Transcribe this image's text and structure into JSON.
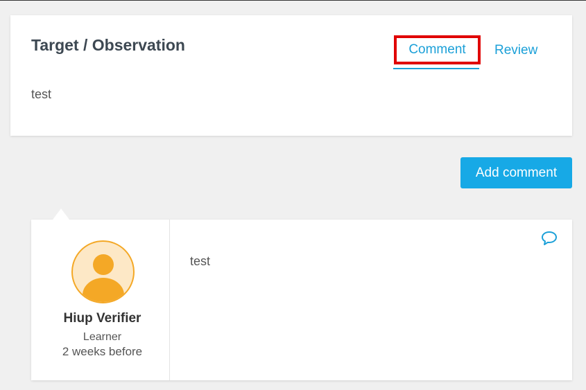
{
  "header": {
    "title": "Target / Observation",
    "description": "test",
    "tabs": [
      {
        "label": "Comment",
        "active": true
      },
      {
        "label": "Review",
        "active": false
      }
    ]
  },
  "actions": {
    "add_comment_label": "Add comment"
  },
  "comments": [
    {
      "author_name": "Hiup Verifier",
      "author_role": "Learner",
      "time": "2 weeks before",
      "text": "test",
      "avatar_icon": "user-avatar-icon",
      "reply_icon": "speech-bubble-icon"
    }
  ],
  "colors": {
    "accent": "#1ba0d8",
    "button": "#17a9e6",
    "highlight": "#e00000",
    "avatar": "#f4a826"
  }
}
